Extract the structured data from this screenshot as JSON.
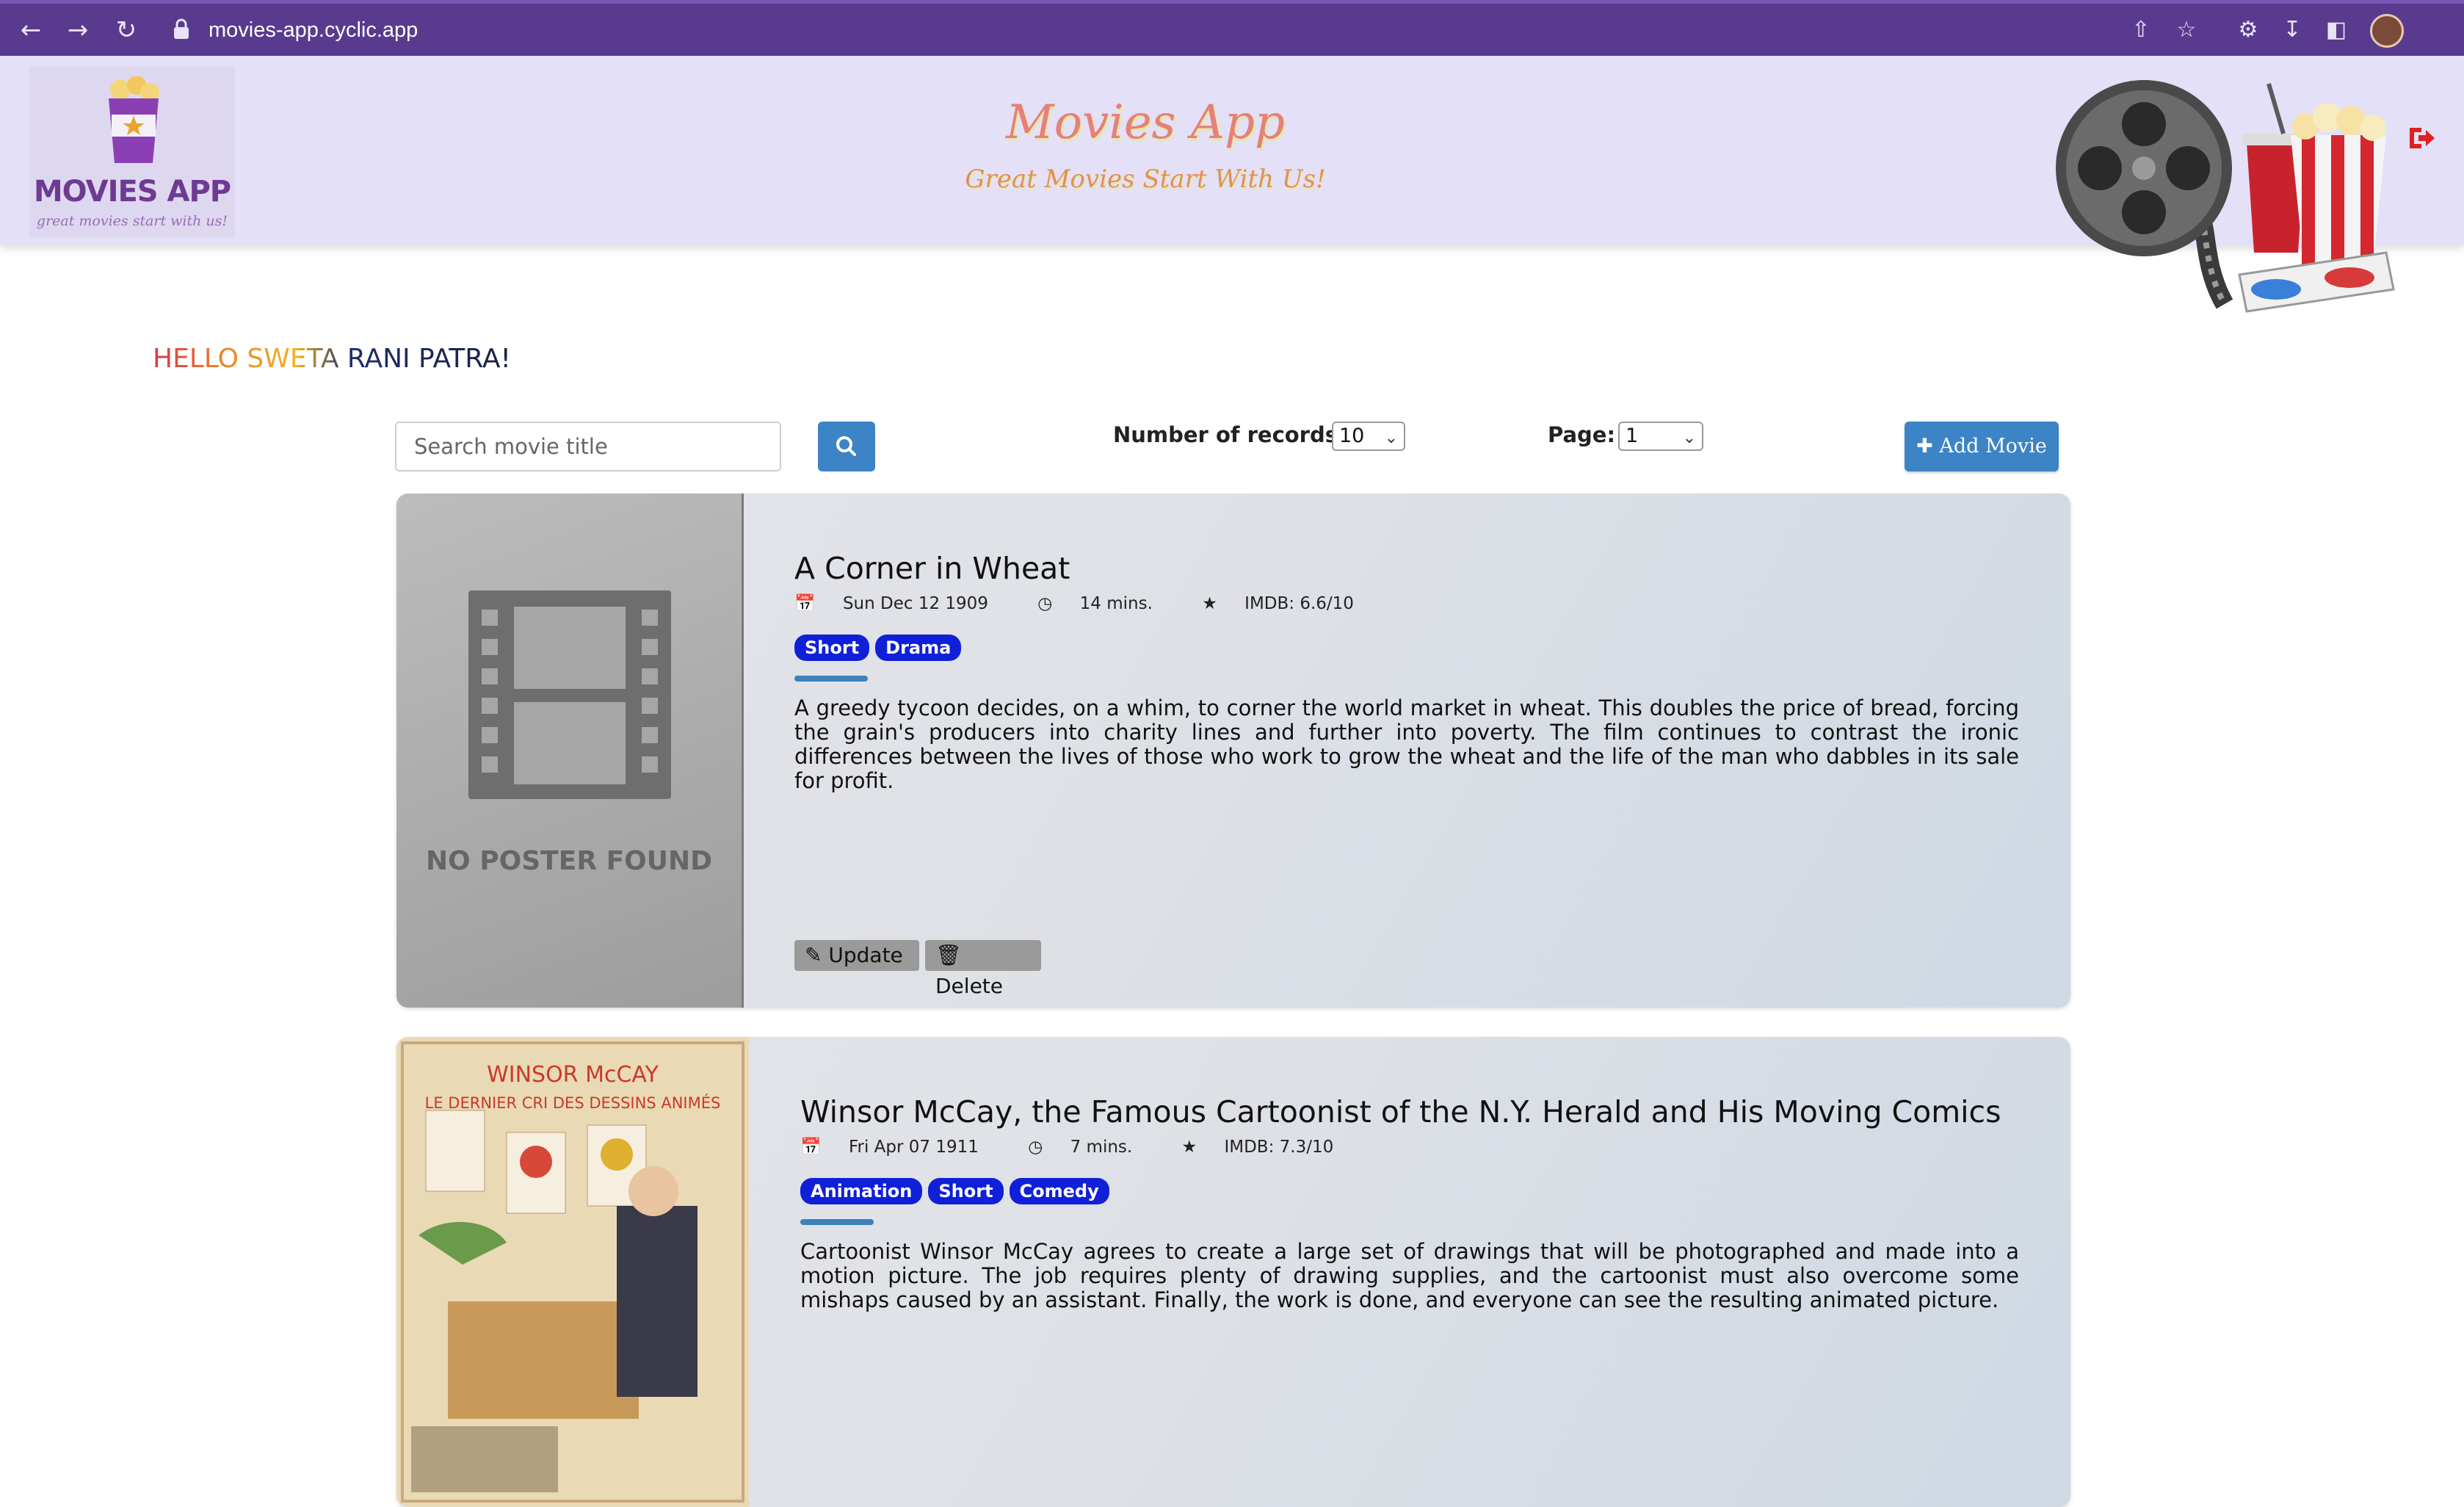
{
  "browser": {
    "url": "movies-app.cyclic.app"
  },
  "header": {
    "logo_text": "MOVIES APP",
    "logo_tagline": "great movies start with us!",
    "title": "Movies App",
    "subtitle": "Great Movies Start With Us!"
  },
  "greeting": "HELLO SWETA RANI PATRA!",
  "controls": {
    "search_placeholder": "Search movie title",
    "records_label": "Number of records:",
    "records_value": "10",
    "page_label": "Page:",
    "page_value": "1",
    "add_movie_label": "Add Movie"
  },
  "movies": [
    {
      "title": "A Corner in Wheat",
      "released": "Sun Dec 12 1909",
      "runtime": "14 mins.",
      "imdb": "IMDB: 6.6/10",
      "genres": [
        "Short",
        "Drama"
      ],
      "plot": "A greedy tycoon decides, on a whim, to corner the world market in wheat. This doubles the price of bread, forcing the grain's producers into charity lines and further into poverty. The film continues to contrast the ironic differences between the lives of those who work to grow the wheat and the life of the man who dabbles in its sale for profit.",
      "poster_text": "NO POSTER FOUND",
      "update_label": "Update",
      "delete_label": "Delete"
    },
    {
      "title": "Winsor McCay, the Famous Cartoonist of the N.Y. Herald and His Moving Comics",
      "released": "Fri Apr 07 1911",
      "runtime": "7 mins.",
      "imdb": "IMDB: 7.3/10",
      "genres": [
        "Animation",
        "Short",
        "Comedy"
      ],
      "plot": "Cartoonist Winsor McCay agrees to create a large set of drawings that will be photographed and made into a motion picture. The job requires plenty of drawing supplies, and the cartoonist must also overcome some mishaps caused by an assistant. Finally, the work is done, and everyone can see the resulting animated picture.",
      "poster_text_line1": "WINSOR McCAY",
      "poster_text_line2": "LE DERNIER CRI DES DESSINS ANIMÉS"
    }
  ]
}
